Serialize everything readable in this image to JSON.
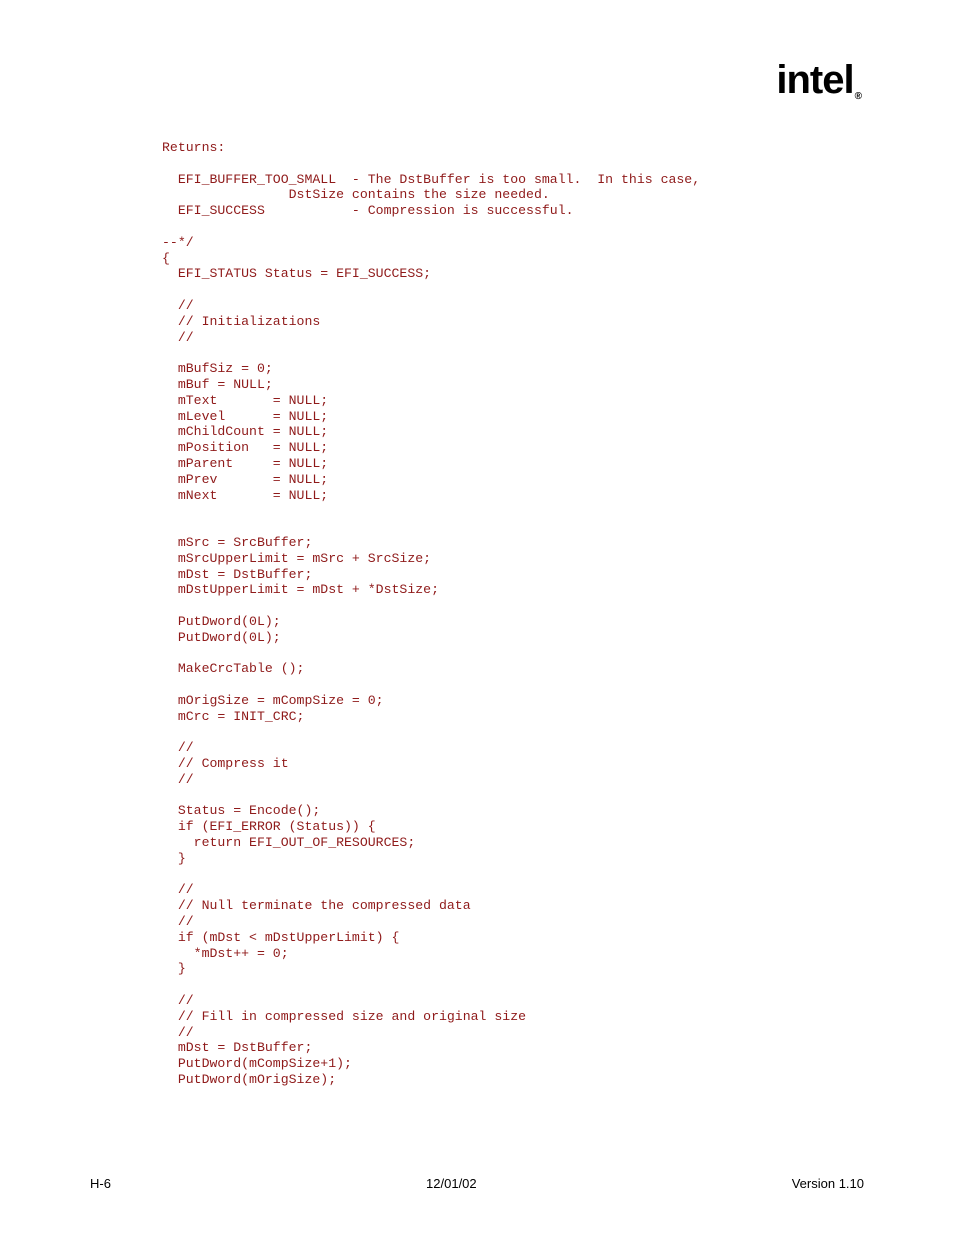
{
  "logo": {
    "text_part1": "int",
    "text_part2": "e",
    "text_part3": "l",
    "reg": "®"
  },
  "code": "Returns:\n\n  EFI_BUFFER_TOO_SMALL  - The DstBuffer is too small.  In this case,\n                DstSize contains the size needed.\n  EFI_SUCCESS           - Compression is successful.\n\n--*/\n{\n  EFI_STATUS Status = EFI_SUCCESS;\n  \n  //\n  // Initializations\n  //\n  \n  mBufSiz = 0;\n  mBuf = NULL;\n  mText       = NULL;\n  mLevel      = NULL;\n  mChildCount = NULL;\n  mPosition   = NULL;\n  mParent     = NULL;\n  mPrev       = NULL;\n  mNext       = NULL;\n\n  \n  mSrc = SrcBuffer;\n  mSrcUpperLimit = mSrc + SrcSize;\n  mDst = DstBuffer;\n  mDstUpperLimit = mDst + *DstSize;\n\n  PutDword(0L);\n  PutDword(0L);\n  \n  MakeCrcTable ();\n\n  mOrigSize = mCompSize = 0;\n  mCrc = INIT_CRC;\n  \n  //\n  // Compress it\n  //\n  \n  Status = Encode();\n  if (EFI_ERROR (Status)) {\n    return EFI_OUT_OF_RESOURCES;\n  }\n  \n  //\n  // Null terminate the compressed data\n  //\n  if (mDst < mDstUpperLimit) {\n    *mDst++ = 0;\n  }\n  \n  //\n  // Fill in compressed size and original size\n  //\n  mDst = DstBuffer;\n  PutDword(mCompSize+1);\n  PutDword(mOrigSize);",
  "footer": {
    "left": "H-6",
    "center": "12/01/02",
    "right": "Version 1.10"
  }
}
